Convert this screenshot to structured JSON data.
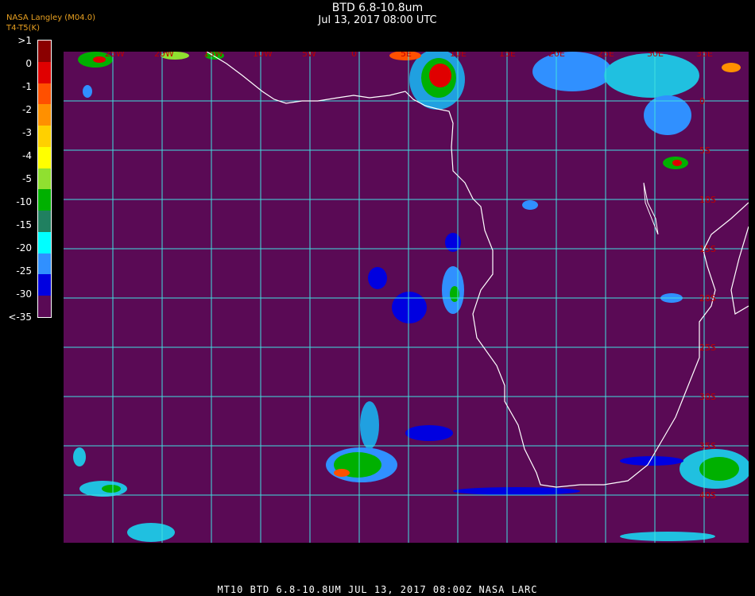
{
  "header": {
    "title": "BTD 6.8-10.8um",
    "datetime": "Jul 13, 2017 08:00 UTC"
  },
  "credit": {
    "line1": "NASA Langley (M04.0)",
    "line2": "T4-T5(K)",
    "overlap": "BTD"
  },
  "colorbar": {
    "labels": [
      ">1",
      "0",
      "-1",
      "-2",
      "-3",
      "-4",
      "-5",
      "-10",
      "-15",
      "-20",
      "-25",
      "-30",
      "<-35"
    ],
    "colors": [
      "#8b0000",
      "#e00000",
      "#ff5000",
      "#ff9000",
      "#ffd000",
      "#ffff00",
      "#90e030",
      "#00b000",
      "#208060",
      "#00ffff",
      "#3090ff",
      "#0000e0",
      "#5a0a55"
    ]
  },
  "map": {
    "background_color": "#5a0a55",
    "grid_color": "#40e0e0",
    "coast_color": "#ffffff",
    "lon_labels": [
      "25W",
      "20W",
      "15W",
      "10W",
      "5W",
      "0",
      "5E",
      "10E",
      "15E",
      "20E",
      "25E",
      "30E",
      "35E"
    ],
    "lat_labels": [
      "0",
      "5S",
      "10S",
      "15S",
      "20S",
      "25S",
      "30S",
      "35S",
      "40S"
    ]
  },
  "footer": {
    "text": "MT10   BTD 6.8-10.8UM    JUL 13, 2017 08:00Z   NASA LARC"
  }
}
